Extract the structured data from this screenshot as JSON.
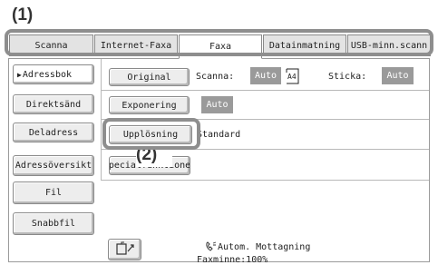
{
  "callouts": {
    "one": "(1)",
    "two": "(2)"
  },
  "tabs": [
    {
      "label": "Scanna"
    },
    {
      "label": "Internet-Faxa"
    },
    {
      "label": "Faxa"
    },
    {
      "label": "Datainmatning"
    },
    {
      "label": "USB-minn.scann"
    }
  ],
  "sidebar": {
    "adressbok": "Adressbok",
    "direktsand": "Direktsänd",
    "deladress": "Deladress",
    "adressoversikt": "Adressöversikt",
    "fil": "Fil",
    "snabbfil": "Snabbfil"
  },
  "settings": {
    "original_button": "Original",
    "scanna_label": "Scanna:",
    "scanna_value": "Auto",
    "paper_size": "A4",
    "sticka_label": "Sticka:",
    "sticka_value": "Auto",
    "exponering_button": "Exponering",
    "exponering_value": "Auto",
    "upplosning_button": "Upplösning",
    "upplosning_value": "Standard",
    "special_button": "Specialfunktionen"
  },
  "status": {
    "reception": "Autom. Mottagning",
    "memory": "Faxminne:100%"
  },
  "colors": {
    "badge": "#9a9a9a",
    "callout_frame": "#8e8e8e"
  }
}
